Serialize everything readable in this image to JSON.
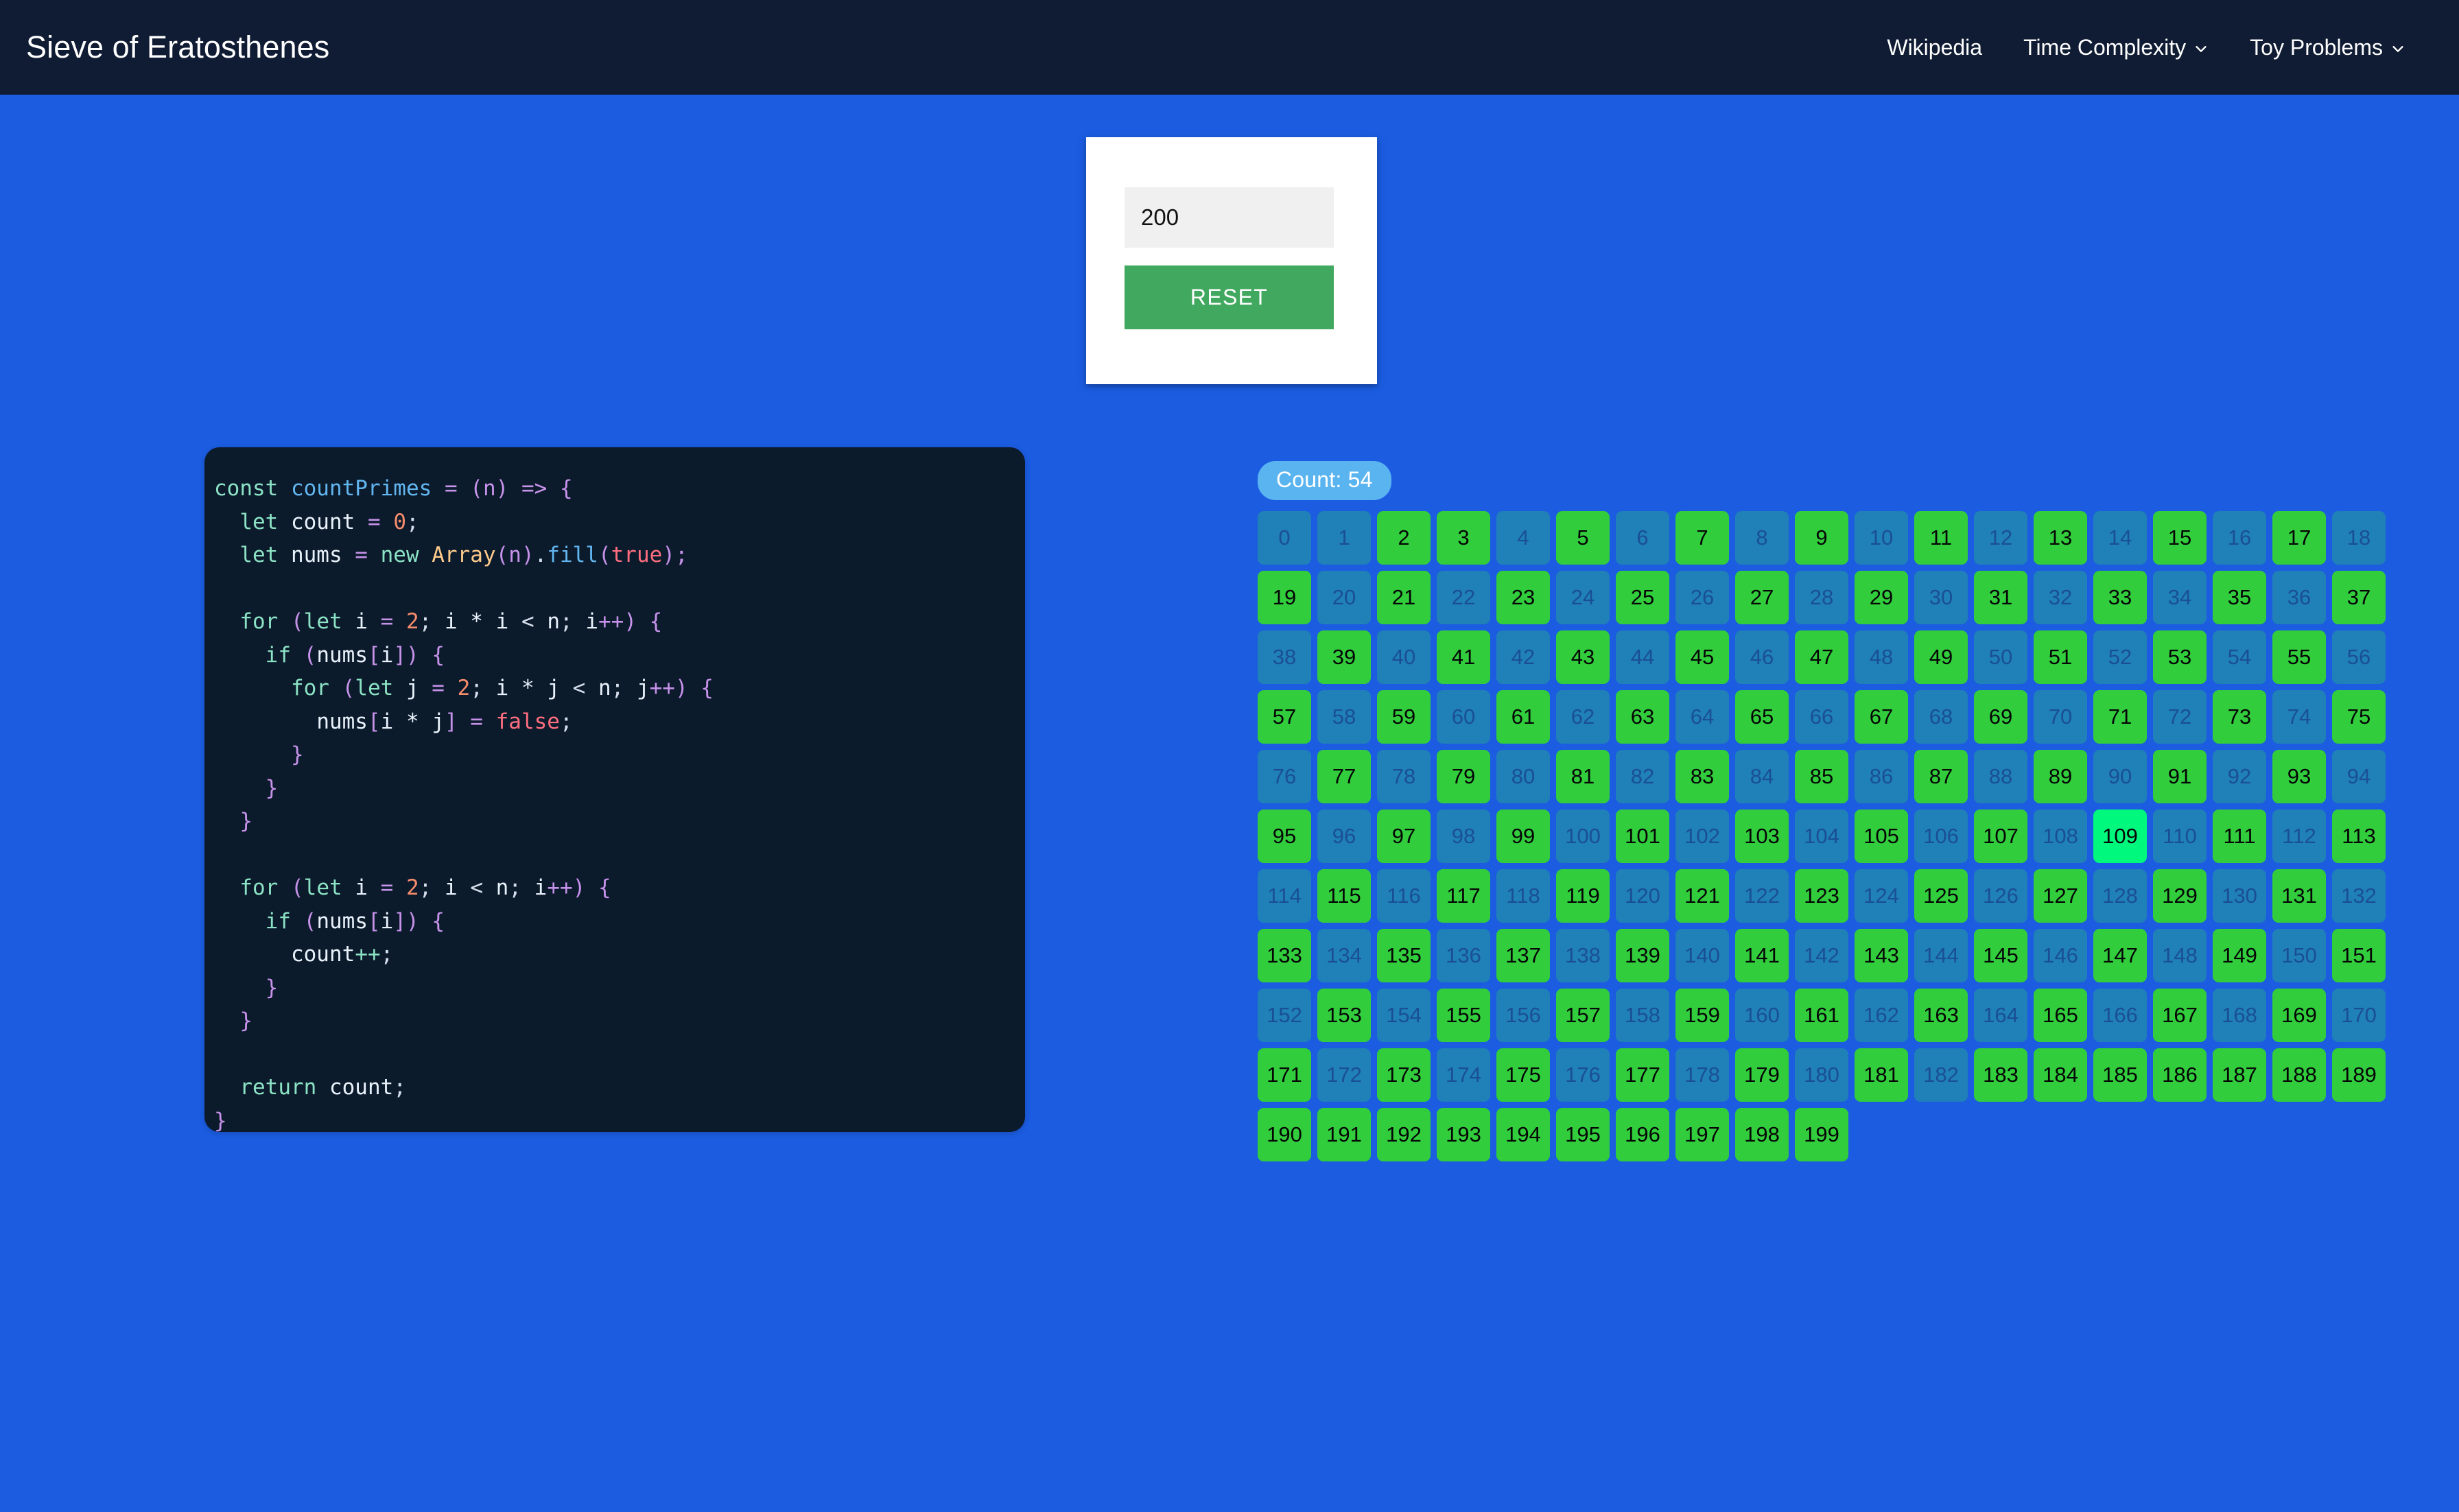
{
  "navbar": {
    "brand": "Sieve of Eratosthenes",
    "links": [
      {
        "label": "Wikipedia",
        "has_caret": false,
        "icon": ""
      },
      {
        "label": "Time Complexity",
        "has_caret": true,
        "icon": "chevron-down-icon"
      },
      {
        "label": "Toy Problems",
        "has_caret": true,
        "icon": "chevron-down-icon"
      }
    ]
  },
  "input_card": {
    "input_value": "200",
    "input_placeholder": "n",
    "reset_label": "RESET"
  },
  "code_panel": {
    "language": "javascript",
    "lines": [
      [
        {
          "t": "const ",
          "c": "kw"
        },
        {
          "t": "countPrimes",
          "c": "fn"
        },
        {
          "t": " = ",
          "c": "op"
        },
        {
          "t": "(n)",
          "c": "op"
        },
        {
          "t": " ",
          "c": "pln"
        },
        {
          "t": "=>",
          "c": "op"
        },
        {
          "t": " {",
          "c": "op"
        }
      ],
      [
        {
          "t": "  ",
          "c": "pln"
        },
        {
          "t": "let ",
          "c": "kw"
        },
        {
          "t": "count",
          "c": "var"
        },
        {
          "t": " = ",
          "c": "op"
        },
        {
          "t": "0",
          "c": "num"
        },
        {
          "t": ";",
          "c": "pln"
        }
      ],
      [
        {
          "t": "  ",
          "c": "pln"
        },
        {
          "t": "let ",
          "c": "kw"
        },
        {
          "t": "nums",
          "c": "var"
        },
        {
          "t": " = ",
          "c": "op"
        },
        {
          "t": "new ",
          "c": "kw"
        },
        {
          "t": "Array",
          "c": "cls"
        },
        {
          "t": "(n)",
          "c": "op"
        },
        {
          "t": ".",
          "c": "pln"
        },
        {
          "t": "fill",
          "c": "fn"
        },
        {
          "t": "(",
          "c": "op"
        },
        {
          "t": "true",
          "c": "bool"
        },
        {
          "t": ");",
          "c": "op"
        }
      ],
      [
        {
          "t": "",
          "c": "pln"
        }
      ],
      [
        {
          "t": "  ",
          "c": "pln"
        },
        {
          "t": "for ",
          "c": "kw"
        },
        {
          "t": "(",
          "c": "op"
        },
        {
          "t": "let ",
          "c": "kw"
        },
        {
          "t": "i",
          "c": "var"
        },
        {
          "t": " = ",
          "c": "op"
        },
        {
          "t": "2",
          "c": "num"
        },
        {
          "t": "; ",
          "c": "pln"
        },
        {
          "t": "i * i",
          "c": "var"
        },
        {
          "t": " < ",
          "c": "pln"
        },
        {
          "t": "n",
          "c": "var"
        },
        {
          "t": "; ",
          "c": "pln"
        },
        {
          "t": "i",
          "c": "var"
        },
        {
          "t": "++",
          "c": "op"
        },
        {
          "t": ")",
          "c": "op"
        },
        {
          "t": " {",
          "c": "op"
        }
      ],
      [
        {
          "t": "    ",
          "c": "pln"
        },
        {
          "t": "if ",
          "c": "kw"
        },
        {
          "t": "(",
          "c": "op"
        },
        {
          "t": "nums",
          "c": "var"
        },
        {
          "t": "[",
          "c": "op"
        },
        {
          "t": "i",
          "c": "var"
        },
        {
          "t": "]",
          "c": "op"
        },
        {
          "t": ")",
          "c": "op"
        },
        {
          "t": " {",
          "c": "op"
        }
      ],
      [
        {
          "t": "      ",
          "c": "pln"
        },
        {
          "t": "for ",
          "c": "kw"
        },
        {
          "t": "(",
          "c": "op"
        },
        {
          "t": "let ",
          "c": "kw"
        },
        {
          "t": "j",
          "c": "var"
        },
        {
          "t": " = ",
          "c": "op"
        },
        {
          "t": "2",
          "c": "num"
        },
        {
          "t": "; ",
          "c": "pln"
        },
        {
          "t": "i * j",
          "c": "var"
        },
        {
          "t": " < ",
          "c": "pln"
        },
        {
          "t": "n",
          "c": "var"
        },
        {
          "t": "; ",
          "c": "pln"
        },
        {
          "t": "j",
          "c": "var"
        },
        {
          "t": "++",
          "c": "op"
        },
        {
          "t": ")",
          "c": "op"
        },
        {
          "t": " {",
          "c": "op"
        }
      ],
      [
        {
          "t": "        ",
          "c": "pln"
        },
        {
          "t": "nums",
          "c": "var"
        },
        {
          "t": "[",
          "c": "op"
        },
        {
          "t": "i * j",
          "c": "var"
        },
        {
          "t": "]",
          "c": "op"
        },
        {
          "t": " = ",
          "c": "op"
        },
        {
          "t": "false",
          "c": "bool"
        },
        {
          "t": ";",
          "c": "pln"
        }
      ],
      [
        {
          "t": "      ",
          "c": "pln"
        },
        {
          "t": "}",
          "c": "op"
        }
      ],
      [
        {
          "t": "    ",
          "c": "pln"
        },
        {
          "t": "}",
          "c": "op"
        }
      ],
      [
        {
          "t": "  ",
          "c": "pln"
        },
        {
          "t": "}",
          "c": "op"
        }
      ],
      [
        {
          "t": "",
          "c": "pln"
        }
      ],
      [
        {
          "t": "  ",
          "c": "pln"
        },
        {
          "t": "for ",
          "c": "kw"
        },
        {
          "t": "(",
          "c": "op"
        },
        {
          "t": "let ",
          "c": "kw"
        },
        {
          "t": "i",
          "c": "var"
        },
        {
          "t": " = ",
          "c": "op"
        },
        {
          "t": "2",
          "c": "num"
        },
        {
          "t": "; ",
          "c": "pln"
        },
        {
          "t": "i",
          "c": "var"
        },
        {
          "t": " < ",
          "c": "pln"
        },
        {
          "t": "n",
          "c": "var"
        },
        {
          "t": "; ",
          "c": "pln"
        },
        {
          "t": "i",
          "c": "var"
        },
        {
          "t": "++",
          "c": "op"
        },
        {
          "t": ")",
          "c": "op"
        },
        {
          "t": " {",
          "c": "op"
        }
      ],
      [
        {
          "t": "    ",
          "c": "pln"
        },
        {
          "t": "if ",
          "c": "kw"
        },
        {
          "t": "(",
          "c": "op"
        },
        {
          "t": "nums",
          "c": "var"
        },
        {
          "t": "[",
          "c": "op"
        },
        {
          "t": "i",
          "c": "var"
        },
        {
          "t": "]",
          "c": "op"
        },
        {
          "t": ")",
          "c": "op"
        },
        {
          "t": " {",
          "c": "op"
        }
      ],
      [
        {
          "t": "      ",
          "c": "pln"
        },
        {
          "t": "count",
          "c": "var"
        },
        {
          "t": "++",
          "c": "kw"
        },
        {
          "t": ";",
          "c": "pln"
        }
      ],
      [
        {
          "t": "    ",
          "c": "pln"
        },
        {
          "t": "}",
          "c": "op"
        }
      ],
      [
        {
          "t": "  ",
          "c": "pln"
        },
        {
          "t": "}",
          "c": "op"
        }
      ],
      [
        {
          "t": "",
          "c": "pln"
        }
      ],
      [
        {
          "t": "  ",
          "c": "pln"
        },
        {
          "t": "return ",
          "c": "kw"
        },
        {
          "t": "count",
          "c": "var"
        },
        {
          "t": ";",
          "c": "pln"
        }
      ],
      [
        {
          "t": "}",
          "c": "op"
        }
      ]
    ]
  },
  "grid": {
    "count_label": "Count: 54",
    "count_value": 54,
    "n": 200,
    "columns": 19,
    "start": 0,
    "end": 199,
    "active_number": 109,
    "sieved_through": 182,
    "composite_numbers": [
      0,
      1,
      4,
      6,
      8,
      10,
      12,
      14,
      16,
      18,
      20,
      22,
      24,
      26,
      28,
      30,
      32,
      34,
      36,
      38,
      40,
      42,
      44,
      46,
      48,
      50,
      52,
      54,
      56,
      58,
      60,
      62,
      64,
      66,
      68,
      70,
      72,
      74,
      76,
      78,
      80,
      82,
      84,
      86,
      88,
      90,
      92,
      94,
      96,
      98,
      100,
      102,
      104,
      106,
      108,
      110,
      112,
      114,
      116,
      118,
      120,
      122,
      124,
      126,
      128,
      130,
      132,
      134,
      136,
      138,
      140,
      142,
      144,
      146,
      148,
      150,
      152,
      154,
      156,
      158,
      160,
      162,
      164,
      166,
      168,
      170,
      172,
      174,
      176,
      178,
      180,
      182
    ]
  },
  "colors": {
    "page_background": "#1b5ce0",
    "navbar_background": "#101c33",
    "card_background": "#ffffff",
    "reset_button": "#41a85f",
    "code_background": "#0b1b2c",
    "count_badge": "#5ab4f0",
    "cell_prime": "#32cd3c",
    "cell_composite": "#2080b8",
    "cell_active": "#00f87d"
  }
}
